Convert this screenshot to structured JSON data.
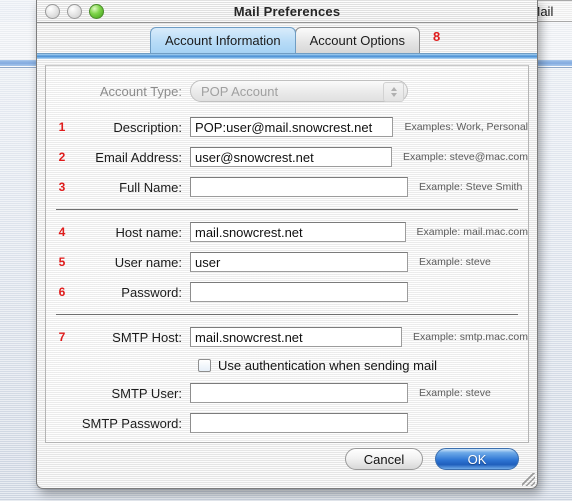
{
  "background": {
    "right_window_title": "l Mail"
  },
  "window": {
    "title": "Mail Preferences",
    "controls": {
      "close": "close-button",
      "minimize": "minimize-button",
      "zoom": "zoom-button"
    }
  },
  "tabs": [
    {
      "label": "Account Information",
      "active": true
    },
    {
      "label": "Account Options",
      "active": false
    }
  ],
  "tab_marker": "8",
  "account_type": {
    "marker": "",
    "label": "Account Type:",
    "value": "POP Account",
    "disabled": true
  },
  "fields": [
    {
      "marker": "1",
      "label": "Description:",
      "value": "POP:user@mail.snowcrest.net",
      "hint": "Examples: Work, Personal",
      "type": "text"
    },
    {
      "marker": "2",
      "label": "Email Address:",
      "value": "user@snowcrest.net",
      "hint": "Example: steve@mac.com",
      "type": "text"
    },
    {
      "marker": "3",
      "label": "Full Name:",
      "value": "",
      "hint": "Example: Steve Smith",
      "type": "text"
    },
    {
      "marker": "4",
      "label": "Host name:",
      "value": "mail.snowcrest.net",
      "hint": "Example: mail.mac.com",
      "type": "text"
    },
    {
      "marker": "5",
      "label": "User name:",
      "value": "user",
      "hint": "Example: steve",
      "type": "text"
    },
    {
      "marker": "6",
      "label": "Password:",
      "value": "",
      "hint": "",
      "type": "password"
    },
    {
      "marker": "7",
      "label": "SMTP Host:",
      "value": "mail.snowcrest.net",
      "hint": "Example: smtp.mac.com",
      "type": "text"
    },
    {
      "marker": "",
      "label": "SMTP User:",
      "value": "",
      "hint": "Example: steve",
      "type": "text"
    },
    {
      "marker": "",
      "label": "SMTP Password:",
      "value": "",
      "hint": "",
      "type": "password"
    }
  ],
  "checkbox": {
    "label": "Use authentication when sending mail",
    "checked": false
  },
  "buttons": {
    "cancel": "Cancel",
    "ok": "OK"
  },
  "colors": {
    "marker_red": "#e01b1b",
    "tab_active_blue": "#b8dcf7",
    "ok_button_blue": "#2f76d4",
    "zoom_green": "#7ed44a"
  }
}
